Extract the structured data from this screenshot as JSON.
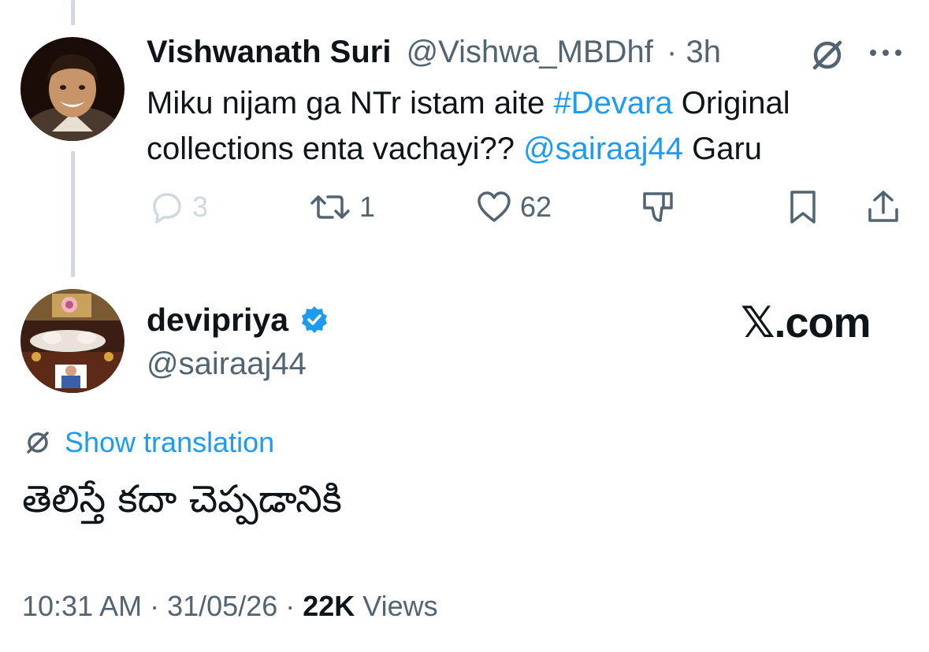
{
  "reply": {
    "author_name": "Vishwanath Suri",
    "author_handle": "@Vishwa_MBDhf",
    "separator": "·",
    "time": "3h",
    "text_1": "Miku nijam ga NTr istam aite ",
    "hashtag": "#Devara",
    "text_2": " Original collections enta vachayi?? ",
    "mention": "@sairaaj44",
    "text_3": " Garu",
    "actions": {
      "replies": "3",
      "reposts": "1",
      "likes": "62"
    },
    "icons": [
      "grok-icon",
      "more-icon",
      "reply-icon",
      "repost-icon",
      "like-icon",
      "dislike-icon",
      "bookmark-icon",
      "share-icon"
    ]
  },
  "main": {
    "author_name": "devipriya",
    "author_handle": "@sairaaj44",
    "verified_color": "#1d9bf0",
    "watermark": "𝕏.com",
    "show_translation": "Show translation",
    "text": "తెలిస్తే కదా చెప్పడానికి",
    "time": "10:31 AM",
    "sep1": " · ",
    "date": "31/05/26",
    "sep2": " · ",
    "views_count": "22K",
    "views_label": " Views"
  },
  "colors": {
    "link": "#1d9bf0",
    "secondary": "#536471",
    "primary": "#0f1419",
    "thread_line": "#cfd9de"
  }
}
